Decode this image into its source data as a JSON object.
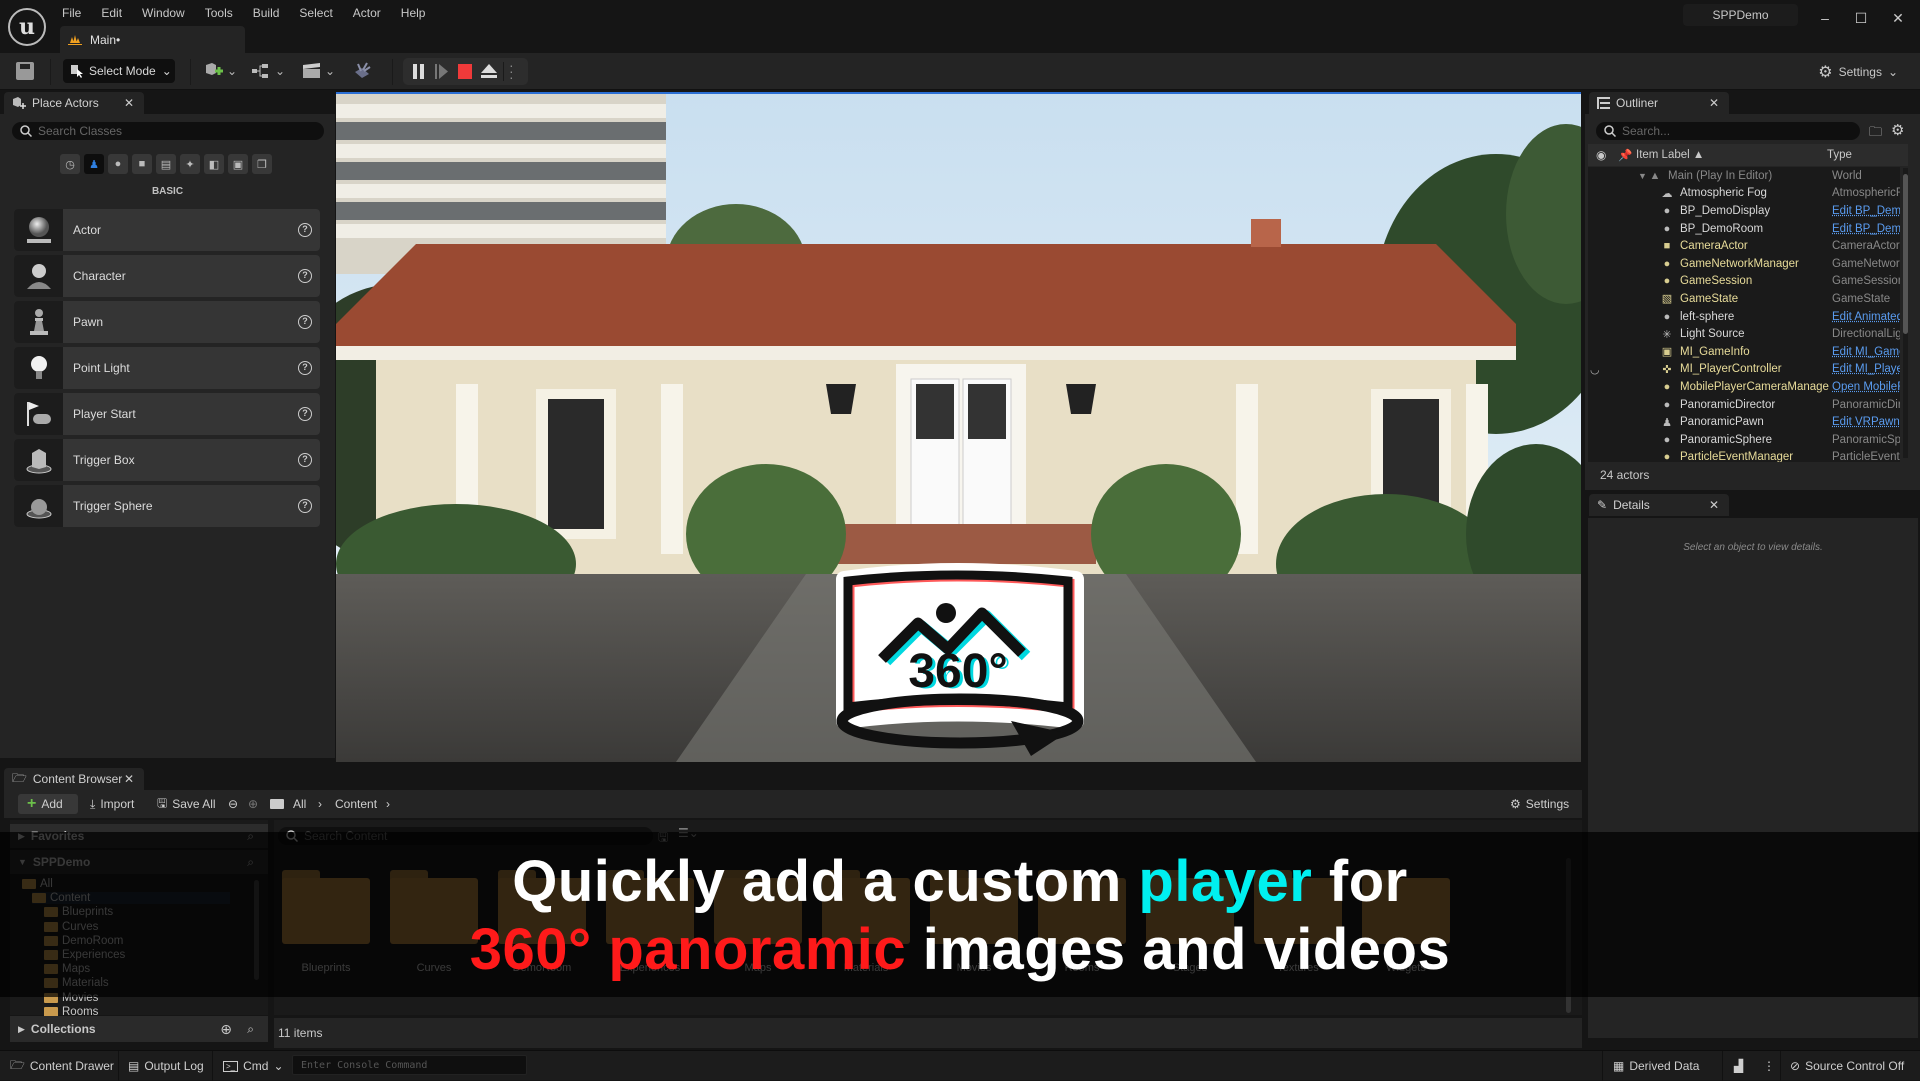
{
  "app": {
    "project_name": "SPPDemo",
    "level_tab": "Main•",
    "menus": [
      "File",
      "Edit",
      "Window",
      "Tools",
      "Build",
      "Select",
      "Actor",
      "Help"
    ],
    "window_controls": {
      "minimize": "–",
      "maximize": "☐",
      "close": "✕"
    }
  },
  "toolbar": {
    "select_mode": "Select Mode",
    "settings": "Settings"
  },
  "place_actors": {
    "tab_label": "Place Actors",
    "search_placeholder": "Search Classes",
    "category_label": "BASIC",
    "categories": [
      "recent",
      "basic",
      "lights",
      "shapes",
      "cinematic",
      "visual-effects",
      "geometry",
      "volumes",
      "all-classes"
    ],
    "items": [
      {
        "label": "Actor",
        "icon": "actor-sphere-icon"
      },
      {
        "label": "Character",
        "icon": "character-icon"
      },
      {
        "label": "Pawn",
        "icon": "pawn-icon"
      },
      {
        "label": "Point Light",
        "icon": "point-light-icon"
      },
      {
        "label": "Player Start",
        "icon": "player-start-icon"
      },
      {
        "label": "Trigger Box",
        "icon": "trigger-box-icon"
      },
      {
        "label": "Trigger Sphere",
        "icon": "trigger-sphere-icon"
      }
    ]
  },
  "outliner": {
    "tab_label": "Outliner",
    "search_placeholder": "Search...",
    "col_label": "Item Label ▲",
    "col_type": "Type",
    "root": {
      "name": "Main (Play In Editor)",
      "type": "World"
    },
    "rows": [
      {
        "name": "Atmospheric Fog",
        "type": "AtmosphericF",
        "link": false,
        "style": "white"
      },
      {
        "name": "BP_DemoDisplay",
        "type": "Edit BP_Demo",
        "link": true,
        "style": "white"
      },
      {
        "name": "BP_DemoRoom",
        "type": "Edit BP_Demo",
        "link": true,
        "style": "white"
      },
      {
        "name": "CameraActor",
        "type": "CameraActor",
        "link": false,
        "style": "yellow"
      },
      {
        "name": "GameNetworkManager",
        "type": "GameNetworkI",
        "link": false,
        "style": "yellow"
      },
      {
        "name": "GameSession",
        "type": "GameSession",
        "link": false,
        "style": "yellow"
      },
      {
        "name": "GameState",
        "type": "GameState",
        "link": false,
        "style": "yellow"
      },
      {
        "name": "left-sphere",
        "type": "Edit Animated",
        "link": true,
        "style": "white"
      },
      {
        "name": "Light Source",
        "type": "DirectionalLig",
        "link": false,
        "style": "white"
      },
      {
        "name": "MI_GameInfo",
        "type": "Edit MI_Game",
        "link": true,
        "style": "yellow"
      },
      {
        "name": "MI_PlayerController",
        "type": "Edit MI_Playe",
        "link": true,
        "style": "yellow"
      },
      {
        "name": "MobilePlayerCameraManage",
        "type": "Open MobileF",
        "link": true,
        "style": "yellow"
      },
      {
        "name": "PanoramicDirector",
        "type": "PanoramicDir",
        "link": false,
        "style": "white"
      },
      {
        "name": "PanoramicPawn",
        "type": "Edit VRPawn",
        "link": true,
        "style": "white"
      },
      {
        "name": "PanoramicSphere",
        "type": "PanoramicSpl",
        "link": false,
        "style": "white"
      },
      {
        "name": "ParticleEventManager",
        "type": "ParticleEventI",
        "link": false,
        "style": "yellow"
      }
    ],
    "actor_count": "24 actors"
  },
  "details": {
    "tab_label": "Details",
    "empty_text": "Select an object to view details."
  },
  "content_browser": {
    "tab_label": "Content Browser",
    "add": "Add",
    "import": "Import",
    "save_all": "Save All",
    "breadcrumb": [
      "All",
      "Content"
    ],
    "settings": "Settings",
    "search_placeholder": "Search Content",
    "sections": {
      "favorites": "Favorites",
      "project": "SPPDemo",
      "collections": "Collections"
    },
    "tree": [
      "All",
      "Content",
      "Blueprints",
      "Curves",
      "DemoRoom",
      "Experiences",
      "Maps",
      "Materials",
      "Movies",
      "Rooms"
    ],
    "folders": [
      "Blueprints",
      "Curves",
      "DemoRoom",
      "Experiences",
      "Maps",
      "Materials",
      "Movies",
      "Rooms",
      "Stages",
      "Textures",
      "Widgets"
    ],
    "item_count": "11 items"
  },
  "caption": {
    "line1_a": "Quickly add a custom ",
    "line1_b": "player",
    "line1_c": " for",
    "line2_a": "360° panoramic",
    "line2_b": " images and videos",
    "accent_cyan": "#00f0f0",
    "accent_red": "#ff1a1a"
  },
  "viewport": {
    "logo_text": "360°"
  },
  "statusbar": {
    "content_drawer": "Content Drawer",
    "output_log": "Output Log",
    "cmd": "Cmd",
    "console_placeholder": "Enter Console Command",
    "derived_data": "Derived Data",
    "source_control": "Source Control Off"
  }
}
